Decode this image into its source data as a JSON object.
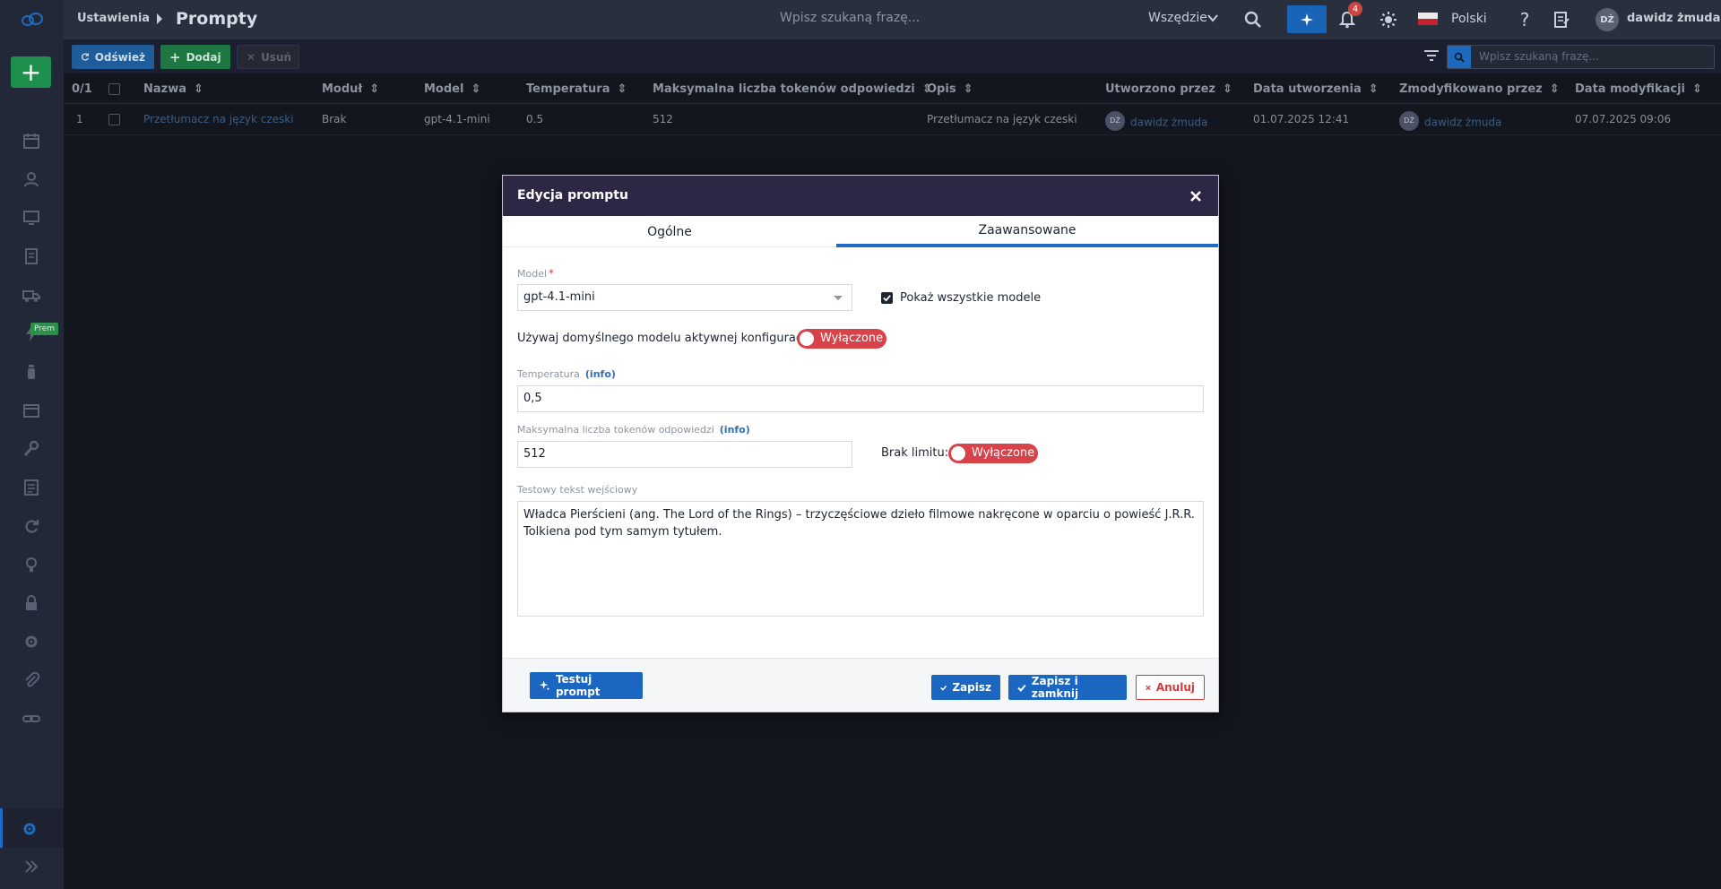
{
  "topbar": {
    "breadcrumb_root": "Ustawienia",
    "page_title": "Prompty",
    "search_placeholder": "Wpisz szukaną frazę...",
    "scope": "Wszędzie",
    "notifications_count": "4",
    "language": "Polski",
    "user_initials": "DŻ",
    "user_name": "dawidz żmuda"
  },
  "sidebar": {
    "premium_badge": "Prem",
    "icons": [
      "calendar-icon",
      "person-icon",
      "monitor-icon",
      "document-icon",
      "truck-icon",
      "bolt-icon",
      "bottle-icon",
      "window-icon",
      "wrench-icon",
      "invoice-icon",
      "sync-icon",
      "lightbulb-icon",
      "lock-icon",
      "gear-refresh-icon",
      "paperclip-icon",
      "link-icon"
    ]
  },
  "toolbar": {
    "refresh_label": "Odśwież",
    "add_label": "Dodaj",
    "delete_label": "Usuń",
    "search_placeholder": "Wpisz szukaną frazę..."
  },
  "grid": {
    "selection_count": "0/1",
    "columns": [
      "Nazwa",
      "Moduł",
      "Model",
      "Temperatura",
      "Maksymalna liczba tokenów odpowiedzi",
      "Opis",
      "Utworzono przez",
      "Data utworzenia",
      "Zmodyfikowano przez",
      "Data modyfikacji"
    ],
    "rows": [
      {
        "index": "1",
        "name": "Przetłumacz na język czeski",
        "module": "Brak",
        "model": "gpt-4.1-mini",
        "temperature": "0.5",
        "max_tokens": "512",
        "description": "Przetłumacz na język czeski",
        "created_by_initials": "DŻ",
        "created_by": "dawidz żmuda",
        "created_date": "01.07.2025 12:41",
        "modified_by_initials": "DŻ",
        "modified_by": "dawidz żmuda",
        "modified_date": "07.07.2025 09:06"
      }
    ]
  },
  "modal": {
    "title": "Edycja promptu",
    "tabs": [
      "Ogólne",
      "Zaawansowane"
    ],
    "active_tab": "Zaawansowane",
    "model_label": "Model",
    "model_value": "gpt-4.1-mini",
    "show_all_models_label": "Pokaż wszystkie modele",
    "show_all_models_checked": true,
    "use_default_label": "Używaj domyślnego modelu aktywnej konfiguracji:",
    "use_default_toggle": "Wyłączone",
    "temperature_label": "Temperatura",
    "temperature_info": "(info)",
    "temperature_value": "0,5",
    "max_tokens_label": "Maksymalna liczba tokenów odpowiedzi",
    "max_tokens_info": "(info)",
    "max_tokens_value": "512",
    "no_limit_label": "Brak limitu:",
    "no_limit_toggle": "Wyłączone",
    "test_input_label": "Testowy tekst wejściowy",
    "test_input_value": "Władca Pierścieni (ang. The Lord of the Rings) – trzyczęściowe dzieło filmowe nakręcone w oparciu o powieść J.R.R. Tolkiena pod tym samym tytułem.",
    "test_button": "Testuj prompt",
    "save_button": "Zapisz",
    "save_close_button": "Zapisz i zamknij",
    "cancel_button": "Anuluj"
  },
  "colors": {
    "topbar_bg": "#2a2f3d",
    "modal_header_bg": "#2e2645",
    "accent_blue": "#1a66c0",
    "toggle_off_red": "#d8434a",
    "add_green": "#1f8f4d"
  }
}
